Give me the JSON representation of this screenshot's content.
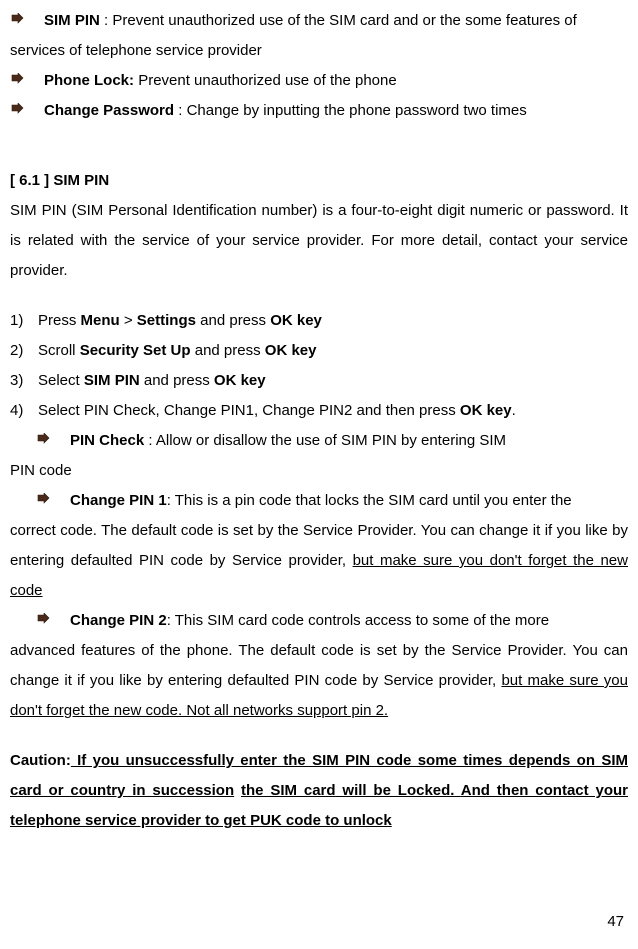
{
  "top_bullets": [
    {
      "label": "SIM PIN",
      "sep": " : ",
      "text": "Prevent unauthorized use of the SIM card and or the some features of",
      "cont": "services of telephone service provider"
    },
    {
      "label": "Phone Lock:",
      "sep": " ",
      "text": "Prevent unauthorized use of the phone",
      "cont": ""
    },
    {
      "label": "Change Password",
      "sep": " : ",
      "text": "Change by inputting the phone password    two times",
      "cont": ""
    }
  ],
  "section": {
    "header": "[ 6.1 ]    SIM PIN",
    "body": "SIM PIN (SIM Personal Identification number) is a four-to-eight digit numeric or password. It is related with the service of your service provider. For more detail, contact your service provider."
  },
  "steps": [
    {
      "num": "1)",
      "pre": "Press ",
      "b1": "Menu",
      "mid": " > ",
      "b2": "Settings",
      "post": " and press ",
      "b3": "OK key"
    },
    {
      "num": "2)",
      "pre": "Scroll ",
      "b1": "Security Set Up",
      "mid": "",
      "b2": "",
      "post": " and press ",
      "b3": "OK key"
    },
    {
      "num": "3)",
      "pre": "Select ",
      "b1": "SIM PIN",
      "mid": "",
      "b2": "",
      "post": " and press ",
      "b3": "OK key"
    },
    {
      "num": "4)",
      "pre": "Select PIN Check, Change PIN1, Change PIN2 and then press ",
      "b1": "",
      "mid": "",
      "b2": "",
      "post": "",
      "b3": "OK key",
      "tail": "."
    }
  ],
  "sub_bullets": [
    {
      "label": "PIN Check",
      "sep": " : ",
      "text": "Allow or disallow the use of SIM PIN by entering SIM",
      "cont": "PIN code",
      "underline": ""
    },
    {
      "label": "Change PIN 1",
      "sep": ": ",
      "text": "This is a pin code that locks the SIM card until you enter the",
      "cont": "correct code. The default code is set by the Service Provider. You can change it if you like by entering defaulted PIN code by Service provider, ",
      "underline": "but make sure you don't forget the new code"
    },
    {
      "label": "Change PIN 2",
      "sep": ": ",
      "text": "This SIM card code controls access to some of the more",
      "cont": "advanced features of the phone. The default code is set by the Service Provider. You can change it if you like by entering defaulted PIN code by Service provider, ",
      "underline": "but make sure you don't forget the new code. Not all networks support pin 2."
    }
  ],
  "caution": {
    "label": "Caution:",
    "u1": " If you unsuccessfully enter the SIM PIN code some times depends on SIM card or country in succession",
    "mid": "   ",
    "u2": "the SIM card",
    "plain": " will be Locked. ",
    "u3": "And then contact your telephone service provider to get PUK code to unlock"
  },
  "page_number": "47"
}
